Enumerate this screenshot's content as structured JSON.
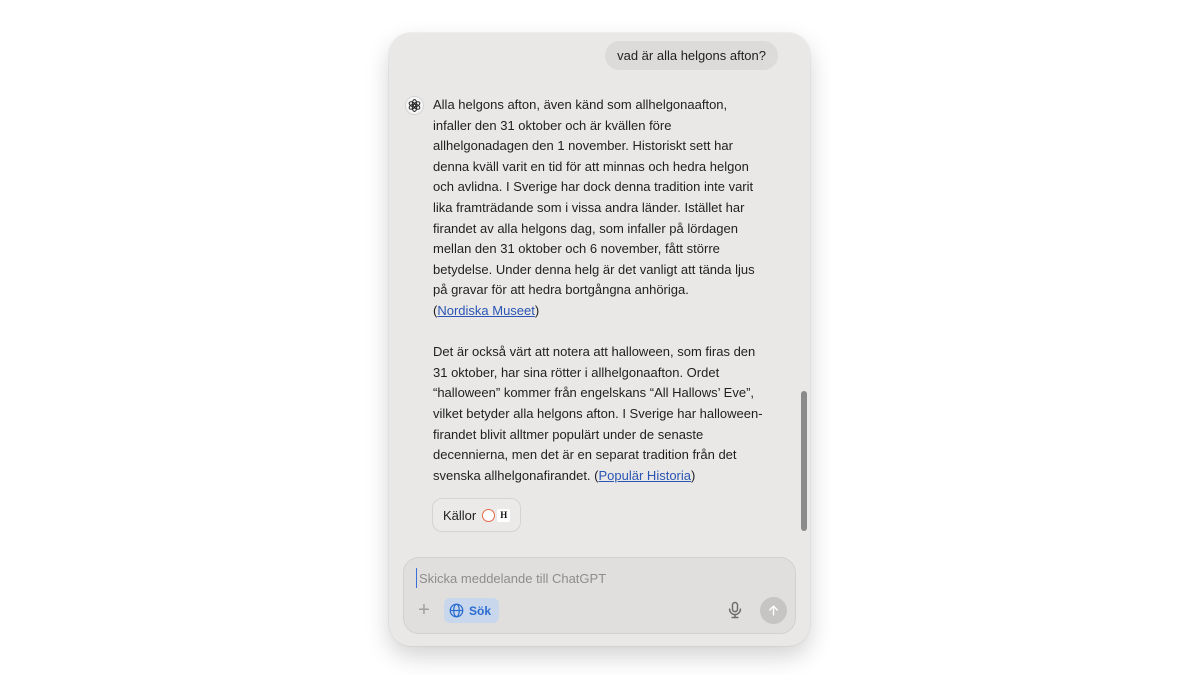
{
  "conversation": {
    "user_message": "vad är alla helgons afton?",
    "assistant": {
      "icon": "openai-logo-icon",
      "paragraph1": "Alla helgons afton, även känd som allhelgonaafton, infaller den 31 oktober och är kvällen före allhelgonadagen den 1 november. Historiskt sett har denna kväll varit en tid för att minnas och hedra helgon och avlidna. I Sverige har dock denna tradition inte varit lika framträdande som i vissa andra länder. Istället har firandet av alla helgons dag, som infaller på lördagen mellan den 31 oktober och 6 november, fått större betydelse. Under denna helg är det vanligt att tända ljus på gravar för att hedra bortgångna anhöriga.",
      "paragraph1_cite_open": "(",
      "paragraph1_link": "Nordiska Museet",
      "paragraph1_cite_close": ")",
      "paragraph2": "Det är också värt att notera att halloween, som firas den 31 oktober, har sina rötter i allhelgonaafton. Ordet “halloween” kommer från engelskans “All Hallows’ Eve”, vilket betyder alla helgons afton. I Sverige har halloween-firandet blivit alltmer populärt under de senaste decennierna, men det är en separat tradition från det svenska allhelgonafirandet.",
      "paragraph2_cite_open": " (",
      "paragraph2_link": "Populär Historia",
      "paragraph2_cite_close": ")",
      "sources_label": "Källor",
      "source_icons": [
        "nordiska-museet-icon",
        "popular-historia-icon"
      ],
      "source_icon_b_letter": "H"
    }
  },
  "composer": {
    "placeholder": "Skicka meddelande till ChatGPT",
    "value": "",
    "search_label": "Sök",
    "icons": [
      "plus-icon",
      "globe-icon",
      "microphone-icon",
      "arrow-up-icon"
    ]
  },
  "colors": {
    "window_bg": "#e9e8e7",
    "link": "#2a55b4",
    "search_accent": "#2a6bd1",
    "search_bg": "#c8d7ec"
  }
}
